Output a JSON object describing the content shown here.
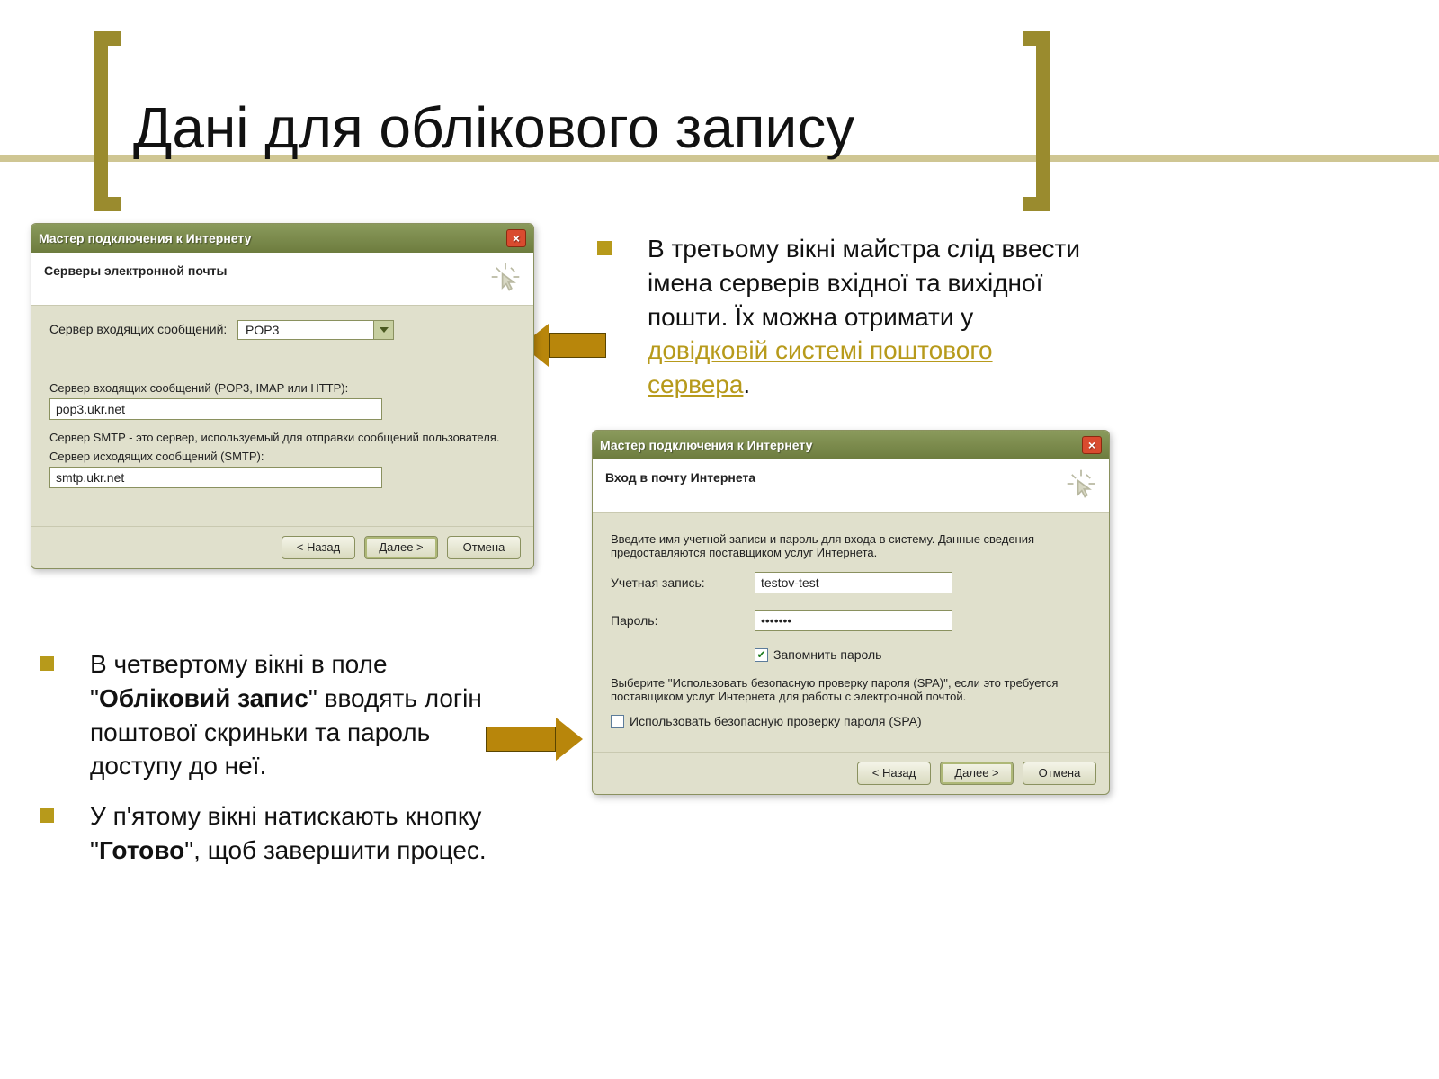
{
  "slide": {
    "title": "Дані для облікового запису"
  },
  "rightBullets": {
    "item1_pre": "В третьому вікні майстра слід ввести імена серверів вхідної та вихідної пошти. Їх можна отримати у ",
    "item1_link": "довідковій системі поштового сервера",
    "item1_post": "."
  },
  "leftBullets": {
    "item1_pre": "В четвертому вікні в поле \"",
    "item1_bold": "Обліковий запис",
    "item1_post": "\" вводять логін поштової скриньки та пароль доступу до неї.",
    "item2_pre": "У п'ятому вікні натискають кнопку \"",
    "item2_bold": "Готово",
    "item2_post": "\", щоб завершити процес."
  },
  "wizard1": {
    "title": "Мастер подключения к Интернету",
    "heading": "Серверы электронной почты",
    "incoming_type_label": "Сервер входящих сообщений:",
    "incoming_type_value": "POP3",
    "incoming_label": "Сервер входящих сообщений (POP3, IMAP или HTTP):",
    "incoming_value": "pop3.ukr.net",
    "smtp_note": "Сервер SMTP - это сервер, используемый для отправки сообщений  пользователя.",
    "outgoing_label": "Сервер исходящих сообщений (SMTP):",
    "outgoing_value": "smtp.ukr.net",
    "back": "< Назад",
    "next": "Далее >",
    "cancel": "Отмена"
  },
  "wizard2": {
    "title": "Мастер подключения к Интернету",
    "heading": "Вход в почту Интернета",
    "intro": "Введите имя учетной записи и пароль для входа в систему. Данные сведения предоставляются поставщиком услуг Интернета.",
    "account_label": "Учетная запись:",
    "account_value": "testov-test",
    "password_label": "Пароль:",
    "password_value": "•••••••",
    "remember": "Запомнить пароль",
    "spa_note": "Выберите ''Использовать безопасную проверку пароля (SPA)'', если это требуется поставщиком услуг Интернета для работы с электронной почтой.",
    "spa_label": "Использовать безопасную проверку пароля (SPA)",
    "back": "< Назад",
    "next": "Далее >",
    "cancel": "Отмена"
  }
}
